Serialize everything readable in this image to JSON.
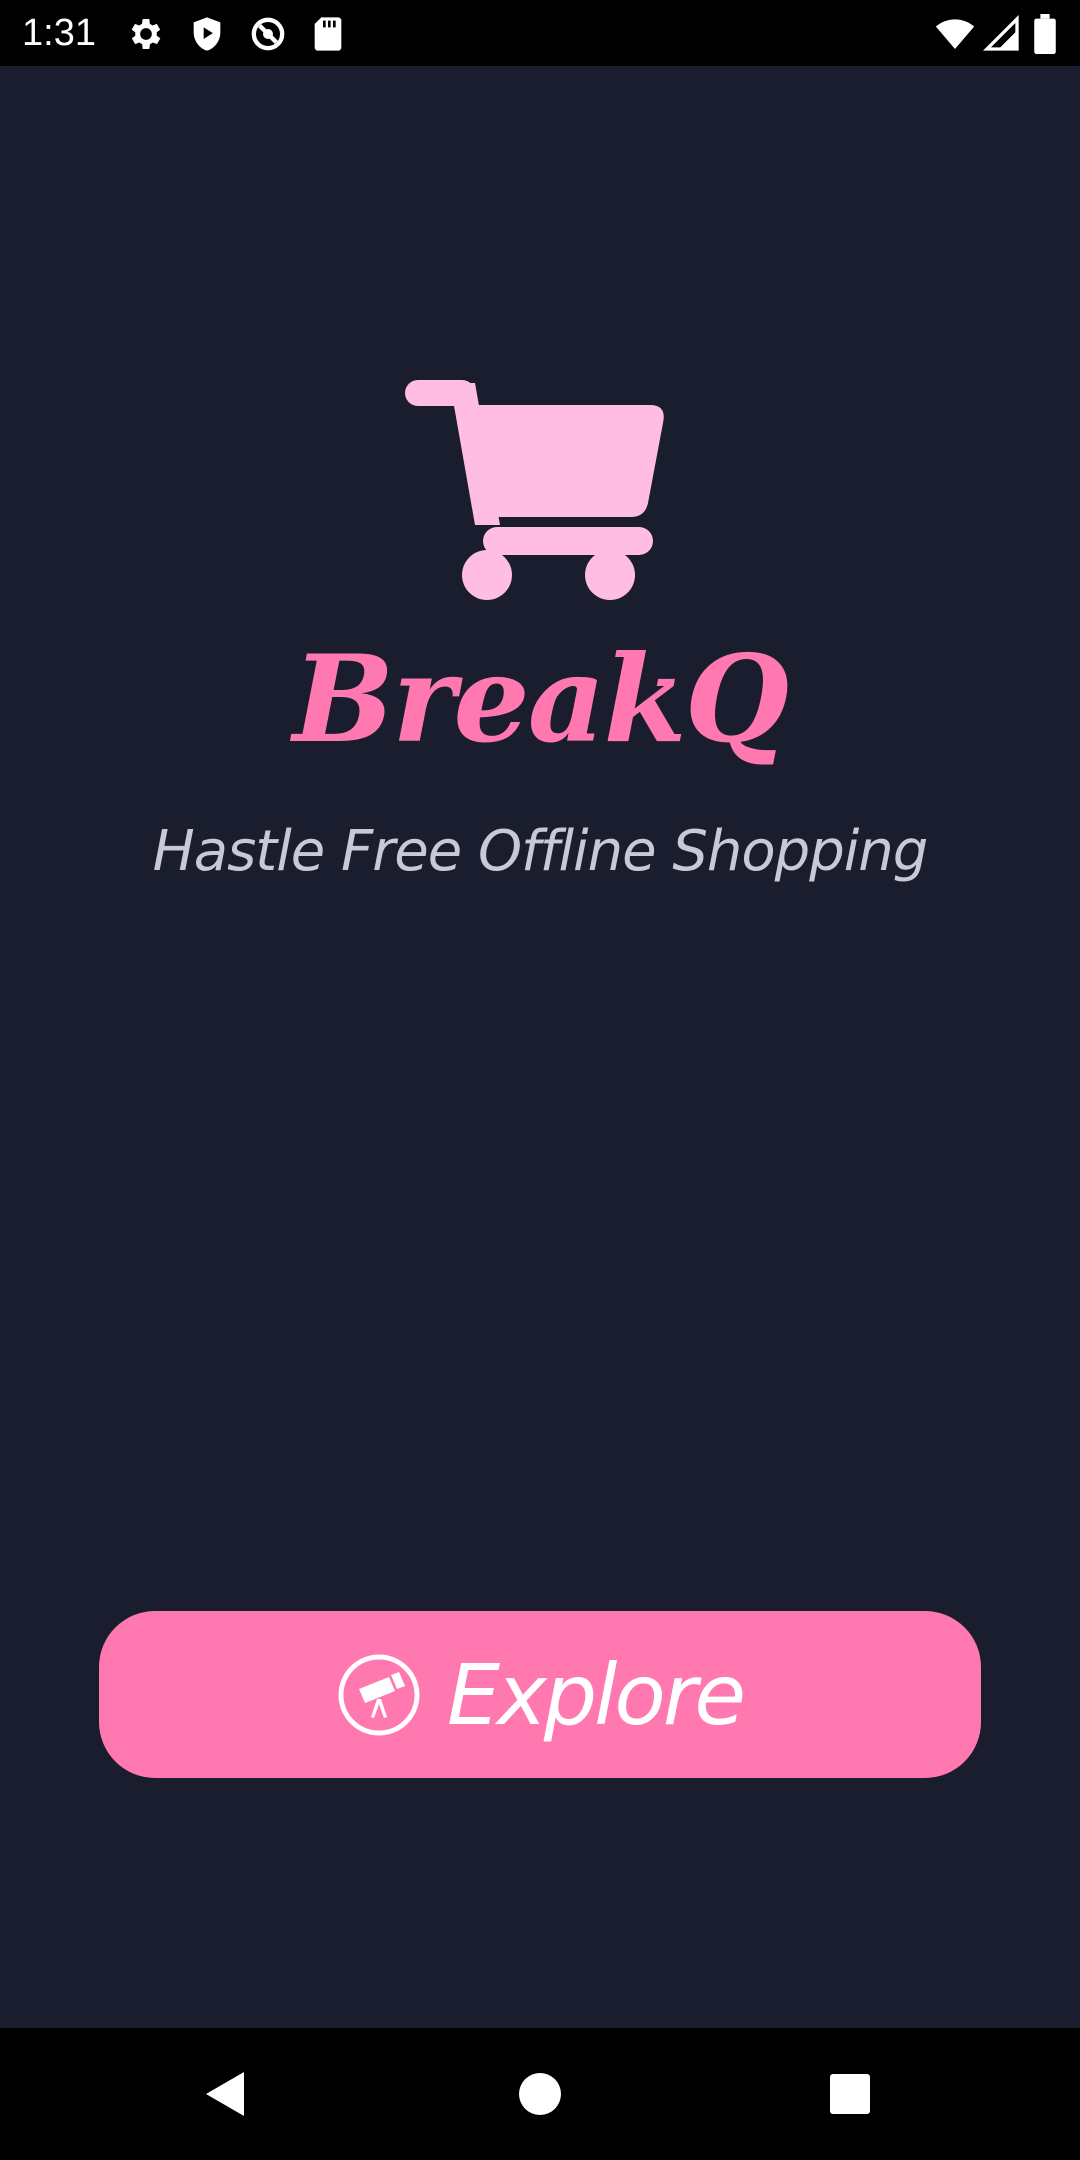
{
  "status_bar": {
    "time": "1:31",
    "icons": [
      "settings-gear-icon",
      "shield-play-icon",
      "vpn-key-icon",
      "sd-card-icon",
      "wifi-icon",
      "cellular-signal-icon",
      "battery-icon"
    ]
  },
  "app": {
    "logo_icon": "shopping-cart-icon",
    "title": "BreakQ",
    "tagline": "Hastle Free Offline Shopping"
  },
  "explore_button": {
    "icon": "telescope-icon",
    "label": "Explore"
  },
  "navigation": {
    "buttons": [
      "back",
      "home",
      "recents"
    ]
  },
  "colors": {
    "background": "#1a1d2e",
    "accent": "#ff79b0",
    "cart": "#ffbde2",
    "tagline": "#c8c9d6"
  }
}
